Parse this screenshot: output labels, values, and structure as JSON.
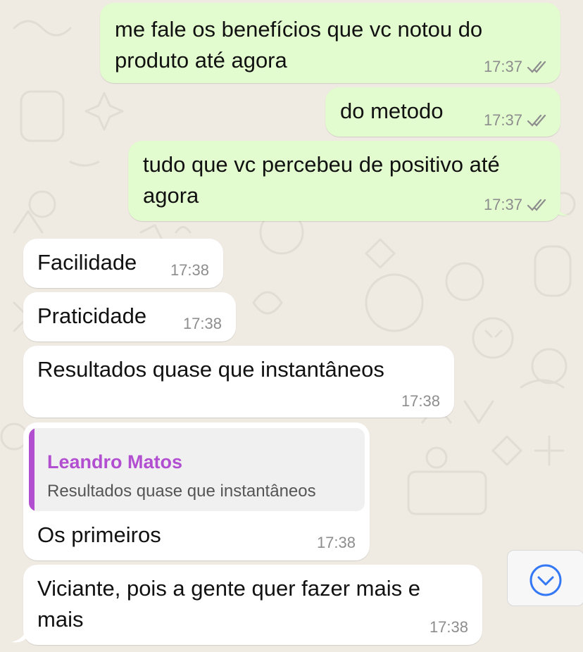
{
  "messages": [
    {
      "dir": "out",
      "text": "me fale os benefícios que vc notou do\nproduto até agora",
      "time": "17:37"
    },
    {
      "dir": "out",
      "text": "do metodo",
      "time": "17:37"
    },
    {
      "dir": "out",
      "text": "tudo que vc percebeu de positivo até\nagora",
      "time": "17:37"
    },
    {
      "dir": "in",
      "text": "Facilidade",
      "time": "17:38"
    },
    {
      "dir": "in",
      "text": "Praticidade",
      "time": "17:38"
    },
    {
      "dir": "in",
      "text": "Resultados quase que instantâneos",
      "time": "17:38"
    },
    {
      "dir": "in",
      "text": "Os primeiros",
      "time": "17:38",
      "quote": {
        "author": "Leandro Matos",
        "text": "Resultados quase que instantâneos"
      }
    },
    {
      "dir": "in",
      "text": "Viciante, pois a gente quer fazer mais e\nmais",
      "time": "17:38"
    }
  ],
  "scroll_button": {
    "icon": "chevron-down-icon"
  },
  "colors": {
    "background": "#efeae2",
    "outgoing_bubble": "#e2fbcf",
    "incoming_bubble": "#ffffff",
    "quote_accent": "#b24fd1",
    "scroll_icon": "#3478f6"
  }
}
